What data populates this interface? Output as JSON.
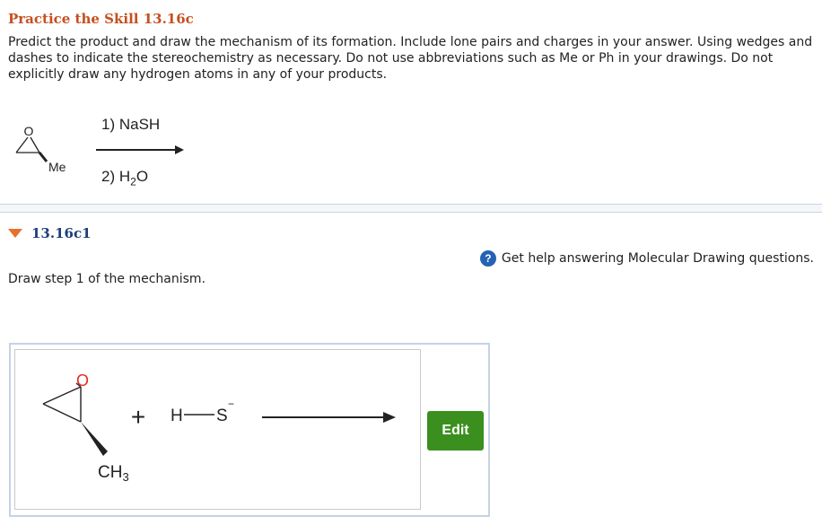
{
  "header": {
    "title": "Practice the Skill 13.16c",
    "instructions": "Predict the product and draw the mechanism of its formation. Include lone pairs and charges in your answer. Using wedges and dashes to indicate the stereochemistry as necessary. Do not use abbreviations such as Me or Ph in your drawings. Do not explicitly draw any hydrogen atoms in any of your products."
  },
  "reaction": {
    "reagent_step1": "1) NaSH",
    "reagent_step2_prefix": "2) H",
    "reagent_step2_sub": "2",
    "reagent_step2_suffix": "O",
    "epoxide_oxygen": "O",
    "methyl_label": "Me"
  },
  "subpart": {
    "title": "13.16c1",
    "help_icon_glyph": "?",
    "help_text": "Get help answering Molecular Drawing questions.",
    "prompt": "Draw step 1 of the mechanism."
  },
  "drawing": {
    "oxygen": "O",
    "plus": "+",
    "h_atom": "H",
    "s_atom": "S",
    "charge": "−",
    "ch3_main": "CH",
    "ch3_sub": "3"
  },
  "edit_button": {
    "label": "Edit"
  },
  "colors": {
    "title": "#c4501f",
    "subtitle": "#1a3f7a",
    "oxygen": "#e0301e",
    "edit_button": "#3a8f1e",
    "help_icon": "#2462b5"
  }
}
